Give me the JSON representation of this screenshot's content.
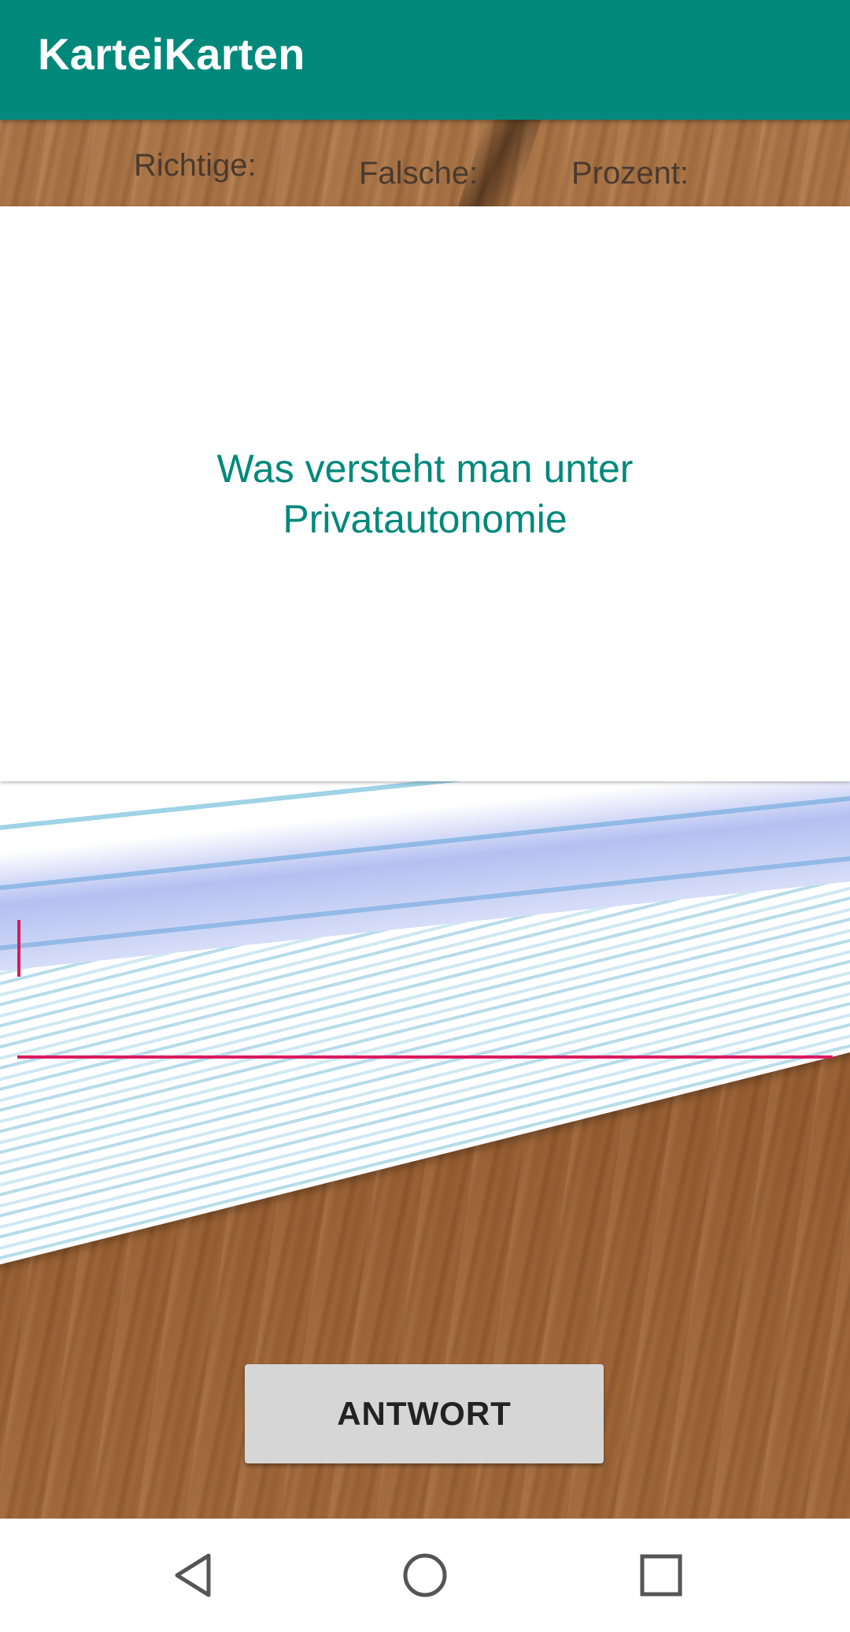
{
  "app_bar": {
    "title": "KarteiKarten",
    "background_color": "#00897b"
  },
  "stats": {
    "correct_label": "Richtige:",
    "wrong_label": "Falsche:",
    "percent_label": "Prozent:"
  },
  "question": {
    "text": "Was versteht man unter Privatautonomie",
    "text_color": "#00897b"
  },
  "answer_input": {
    "value": "",
    "placeholder": "",
    "accent_color": "#d81b60"
  },
  "answer_button": {
    "label": "ANTWORT"
  },
  "nav_bar": {
    "icons": [
      "back-triangle-icon",
      "home-circle-icon",
      "recents-square-icon"
    ]
  }
}
